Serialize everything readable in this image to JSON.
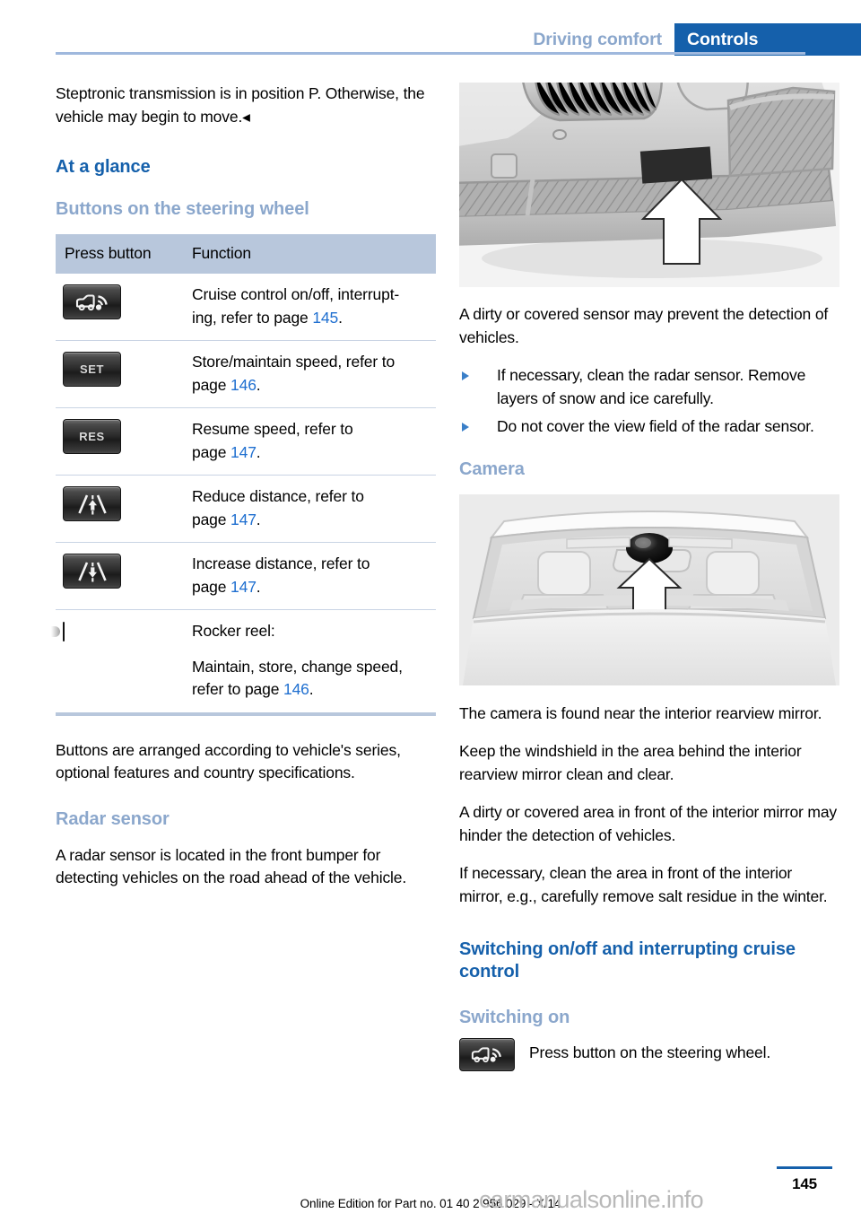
{
  "header": {
    "breadcrumb_section": "Driving comfort",
    "active_tab": "Controls",
    "accent_blue": "#1560ab",
    "muted_blue": "#8ba7cc"
  },
  "left_column": {
    "intro_paragraph": "Steptronic transmission is in position P. Otherwise, the vehicle may begin to move.◂",
    "heading_at_a_glance": "At a glance",
    "heading_buttons": "Buttons on the steering wheel",
    "table": {
      "columns": [
        "Press button",
        "Function"
      ],
      "rows": [
        {
          "icon": "cruise-control-button-icon",
          "icon_label": "",
          "lines": [
            "Cruise control on/off, interrupt-",
            "ing, refer to page "
          ],
          "ref_page": "145",
          "ref_suffix": "."
        },
        {
          "icon": "set-button-icon",
          "icon_label": "SET",
          "lines": [
            "Store/maintain speed, refer to",
            "page "
          ],
          "ref_page": "146",
          "ref_suffix": "."
        },
        {
          "icon": "res-button-icon",
          "icon_label": "RES",
          "lines": [
            "Resume speed, refer to",
            "page "
          ],
          "ref_page": "147",
          "ref_suffix": "."
        },
        {
          "icon": "reduce-distance-button-icon",
          "icon_label": "",
          "lines": [
            "Reduce distance, refer to",
            "page "
          ],
          "ref_page": "147",
          "ref_suffix": "."
        },
        {
          "icon": "increase-distance-button-icon",
          "icon_label": "",
          "lines": [
            "Increase distance, refer to",
            "page "
          ],
          "ref_page": "147",
          "ref_suffix": "."
        },
        {
          "icon": "rocker-reel-icon",
          "icon_label": "",
          "lines": [
            "Rocker reel:",
            "Maintain, store, change speed,",
            "refer to page "
          ],
          "ref_page": "146",
          "ref_suffix": "."
        }
      ]
    },
    "after_table_paragraph": "Buttons are arranged according to vehicle's series, optional features and country specifications.",
    "heading_radar_sensor": "Radar sensor",
    "radar_paragraph": "A radar sensor is located in the front bumper for detecting vehicles on the road ahead of the vehicle."
  },
  "right_column": {
    "figure_radar_alt": "Front bumper of car with arrow pointing to radar sensor",
    "radar_dirty_paragraph": "A dirty or covered sensor may prevent the detection of vehicles.",
    "radar_bullets": [
      "If necessary, clean the radar sensor. Remove layers of snow and ice carefully.",
      "Do not cover the view field of the radar sensor."
    ],
    "heading_camera": "Camera",
    "figure_camera_alt": "Windshield interior with arrow pointing to camera near rearview mirror",
    "camera_paragraphs": [
      "The camera is found near the interior rearview mirror.",
      "Keep the windshield in the area behind the interior rearview mirror clean and clear.",
      "A dirty or covered area in front of the interior mirror may hinder the detection of vehicles.",
      "If necessary, clean the area in front of the interior mirror, e.g., carefully remove salt residue in the winter."
    ],
    "heading_switching": "Switching on/off and interrupting cruise control",
    "heading_switching_on": "Switching on",
    "switching_on_step": "Press button on the steering wheel.",
    "switching_on_icon": "cruise-control-button-icon"
  },
  "footer": {
    "page_number": "145",
    "online_edition": "Online Edition for Part no. 01 40 2 956 029 - X/14",
    "watermark": "carmanualsonline.info"
  }
}
